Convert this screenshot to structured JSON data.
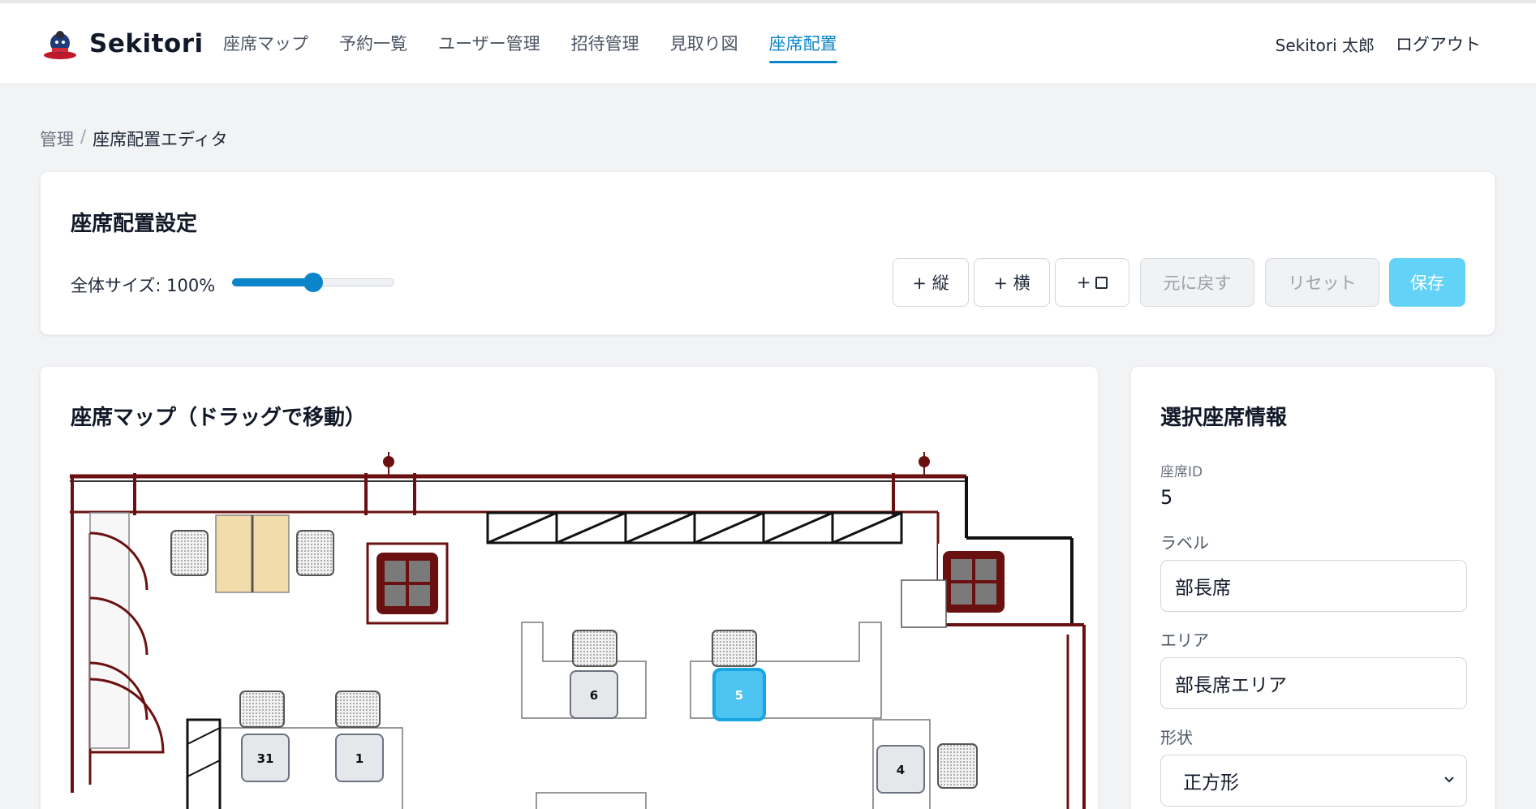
{
  "app": {
    "name": "Sekitori",
    "logo_icon": "sumo-mascot-icon"
  },
  "nav": {
    "items": [
      {
        "label": "座席マップ",
        "active": false
      },
      {
        "label": "予約一覧",
        "active": false
      },
      {
        "label": "ユーザー管理",
        "active": false
      },
      {
        "label": "招待管理",
        "active": false
      },
      {
        "label": "見取り図",
        "active": false
      },
      {
        "label": "座席配置",
        "active": true
      }
    ],
    "user_name": "Sekitori 太郎",
    "logout_label": "ログアウト"
  },
  "breadcrumb": {
    "parent": "管理",
    "separator": "/",
    "current": "座席配置エディタ"
  },
  "settings": {
    "title": "座席配置設定",
    "size_label": "全体サイズ: 100%",
    "size_slider_fraction": 0.5,
    "buttons": {
      "add_vertical": "+ 縦",
      "add_horizontal": "+ 横",
      "add_square_prefix": "+",
      "undo": "元に戻す",
      "reset": "リセット",
      "save": "保存"
    }
  },
  "map": {
    "title": "座席マップ（ドラッグで移動）",
    "seats": [
      {
        "label": "31",
        "selected": false
      },
      {
        "label": "1",
        "selected": false
      },
      {
        "label": "6",
        "selected": false
      },
      {
        "label": "5",
        "selected": true
      },
      {
        "label": "4",
        "selected": false
      }
    ]
  },
  "info": {
    "title": "選択座席情報",
    "seat_id_label": "座席ID",
    "seat_id_value": "5",
    "label_label": "ラベル",
    "label_value": "部長席",
    "area_label": "エリア",
    "area_value": "部長席エリア",
    "shape_label": "形状",
    "shape_value": "正方形"
  },
  "colors": {
    "accent": "#0b84c9",
    "save_button": "#62d3f7",
    "selected_seat": "#4cc3f1",
    "wall": "#6b1010"
  }
}
